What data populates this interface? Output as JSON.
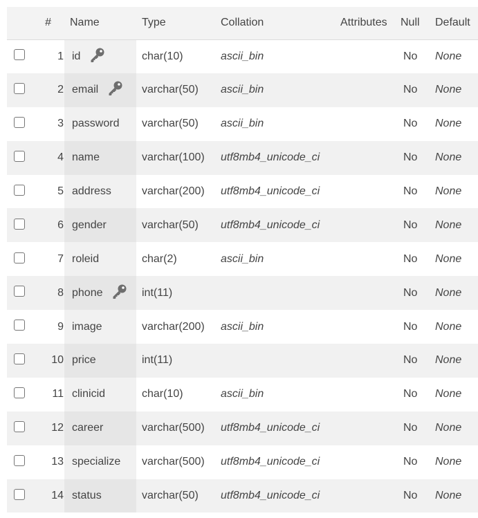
{
  "headers": {
    "num": "#",
    "name": "Name",
    "type": "Type",
    "collation": "Collation",
    "attributes": "Attributes",
    "null": "Null",
    "default": "Default"
  },
  "rows": [
    {
      "num": "1",
      "name": "id",
      "type": "char(10)",
      "collation": "ascii_bin",
      "attributes": "",
      "null": "No",
      "default": "None",
      "key_icon": "key-icon"
    },
    {
      "num": "2",
      "name": "email",
      "type": "varchar(50)",
      "collation": "ascii_bin",
      "attributes": "",
      "null": "No",
      "default": "None",
      "key_icon": "key-icon"
    },
    {
      "num": "3",
      "name": "password",
      "type": "varchar(50)",
      "collation": "ascii_bin",
      "attributes": "",
      "null": "No",
      "default": "None"
    },
    {
      "num": "4",
      "name": "name",
      "type": "varchar(100)",
      "collation": "utf8mb4_unicode_ci",
      "attributes": "",
      "null": "No",
      "default": "None"
    },
    {
      "num": "5",
      "name": "address",
      "type": "varchar(200)",
      "collation": "utf8mb4_unicode_ci",
      "attributes": "",
      "null": "No",
      "default": "None"
    },
    {
      "num": "6",
      "name": "gender",
      "type": "varchar(50)",
      "collation": "utf8mb4_unicode_ci",
      "attributes": "",
      "null": "No",
      "default": "None"
    },
    {
      "num": "7",
      "name": "roleid",
      "type": "char(2)",
      "collation": "ascii_bin",
      "attributes": "",
      "null": "No",
      "default": "None"
    },
    {
      "num": "8",
      "name": "phone",
      "type": "int(11)",
      "collation": "",
      "attributes": "",
      "null": "No",
      "default": "None",
      "key_icon": "key-icon"
    },
    {
      "num": "9",
      "name": "image",
      "type": "varchar(200)",
      "collation": "ascii_bin",
      "attributes": "",
      "null": "No",
      "default": "None"
    },
    {
      "num": "10",
      "name": "price",
      "type": "int(11)",
      "collation": "",
      "attributes": "",
      "null": "No",
      "default": "None"
    },
    {
      "num": "11",
      "name": "clinicid",
      "type": "char(10)",
      "collation": "ascii_bin",
      "attributes": "",
      "null": "No",
      "default": "None"
    },
    {
      "num": "12",
      "name": "career",
      "type": "varchar(500)",
      "collation": "utf8mb4_unicode_ci",
      "attributes": "",
      "null": "No",
      "default": "None"
    },
    {
      "num": "13",
      "name": "specialize",
      "type": "varchar(500)",
      "collation": "utf8mb4_unicode_ci",
      "attributes": "",
      "null": "No",
      "default": "None"
    },
    {
      "num": "14",
      "name": "status",
      "type": "varchar(50)",
      "collation": "utf8mb4_unicode_ci",
      "attributes": "",
      "null": "No",
      "default": "None"
    }
  ],
  "colors": {
    "header_bg": "#f3f3f3",
    "row_alt_bg": "#f1f1f1",
    "name_col_bg": "#e6e6e6",
    "text": "#444444",
    "key_icon": "#6e6e6e"
  }
}
